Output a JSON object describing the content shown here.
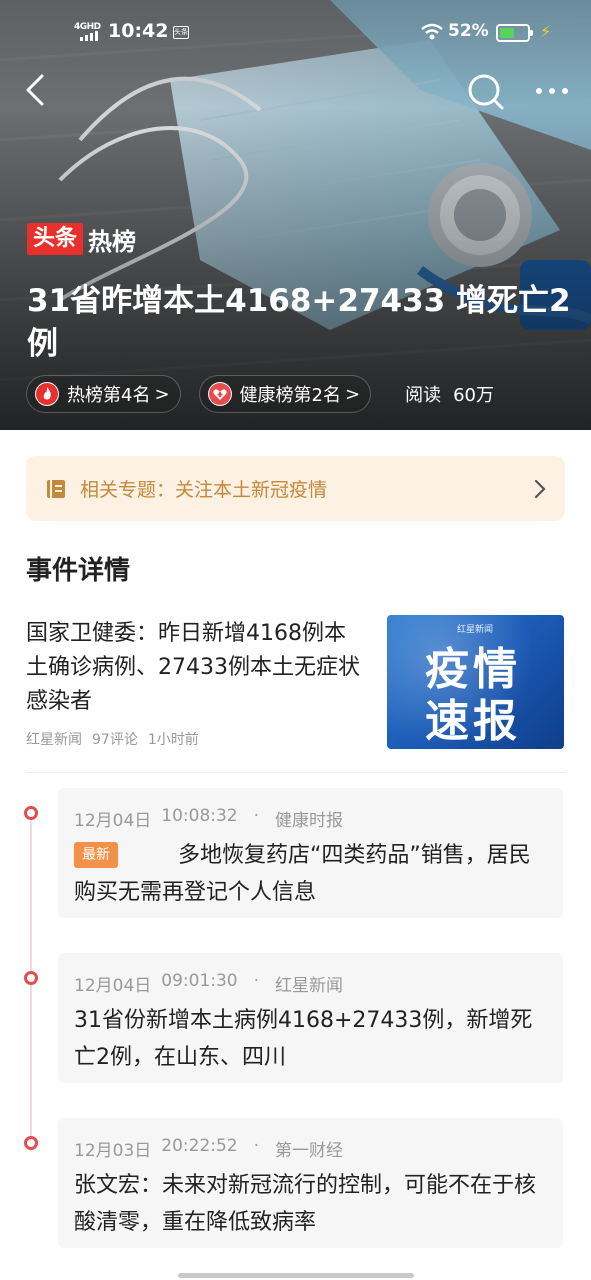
{
  "status_bar": {
    "network": "4GHD",
    "time": "10:42",
    "app_badge": "头条",
    "battery": "52%"
  },
  "hero": {
    "brand": {
      "part1": "头条",
      "part2": "热榜"
    },
    "headline": "31省昨增本土4168+27433  增死亡2例",
    "chips": [
      {
        "label": "热榜第4名",
        "arrow": ">",
        "icon": "flame-icon",
        "color": "#e8302d"
      },
      {
        "label": "健康榜第2名",
        "arrow": ">",
        "icon": "heart-plus-icon",
        "color": "#e64b4f"
      }
    ],
    "reads": {
      "label": "阅读",
      "value": "60万"
    }
  },
  "topic": {
    "label": "相关专题：关注本土新冠疫情",
    "icon": "book-icon",
    "accent": "#c5893c",
    "bg": "#fdf1e4"
  },
  "section_title": "事件详情",
  "lead_article": {
    "title": "国家卫健委：昨日新增4168例本土确诊病例、27433例本土无症状感染者",
    "source": "红星新闻",
    "comments": "97评论",
    "time": "1小时前",
    "thumb": {
      "source_mark": "红星新闻",
      "line1": "疫情",
      "line2": "速报"
    }
  },
  "timeline": [
    {
      "date": "12月04日",
      "time": "10:08:32",
      "dot": "·",
      "source": "健康时报",
      "badge": "最新",
      "text": "多地恢复药店“四类药品”销售，居民购买无需再登记个人信息"
    },
    {
      "date": "12月04日",
      "time": "09:01:30",
      "dot": "·",
      "source": "红星新闻",
      "badge": "",
      "text": "31省份新增本土病例4168+27433例，新增死亡2例，在山东、四川"
    },
    {
      "date": "12月03日",
      "time": "20:22:52",
      "dot": "·",
      "source": "第一财经",
      "badge": "",
      "text": "张文宏：未来对新冠流行的控制，可能不在于核酸清零，重在降低致病率"
    }
  ],
  "colors": {
    "accent_red": "#e8302d",
    "timeline_dot": "#e64b4f",
    "badge": "#f29147"
  }
}
